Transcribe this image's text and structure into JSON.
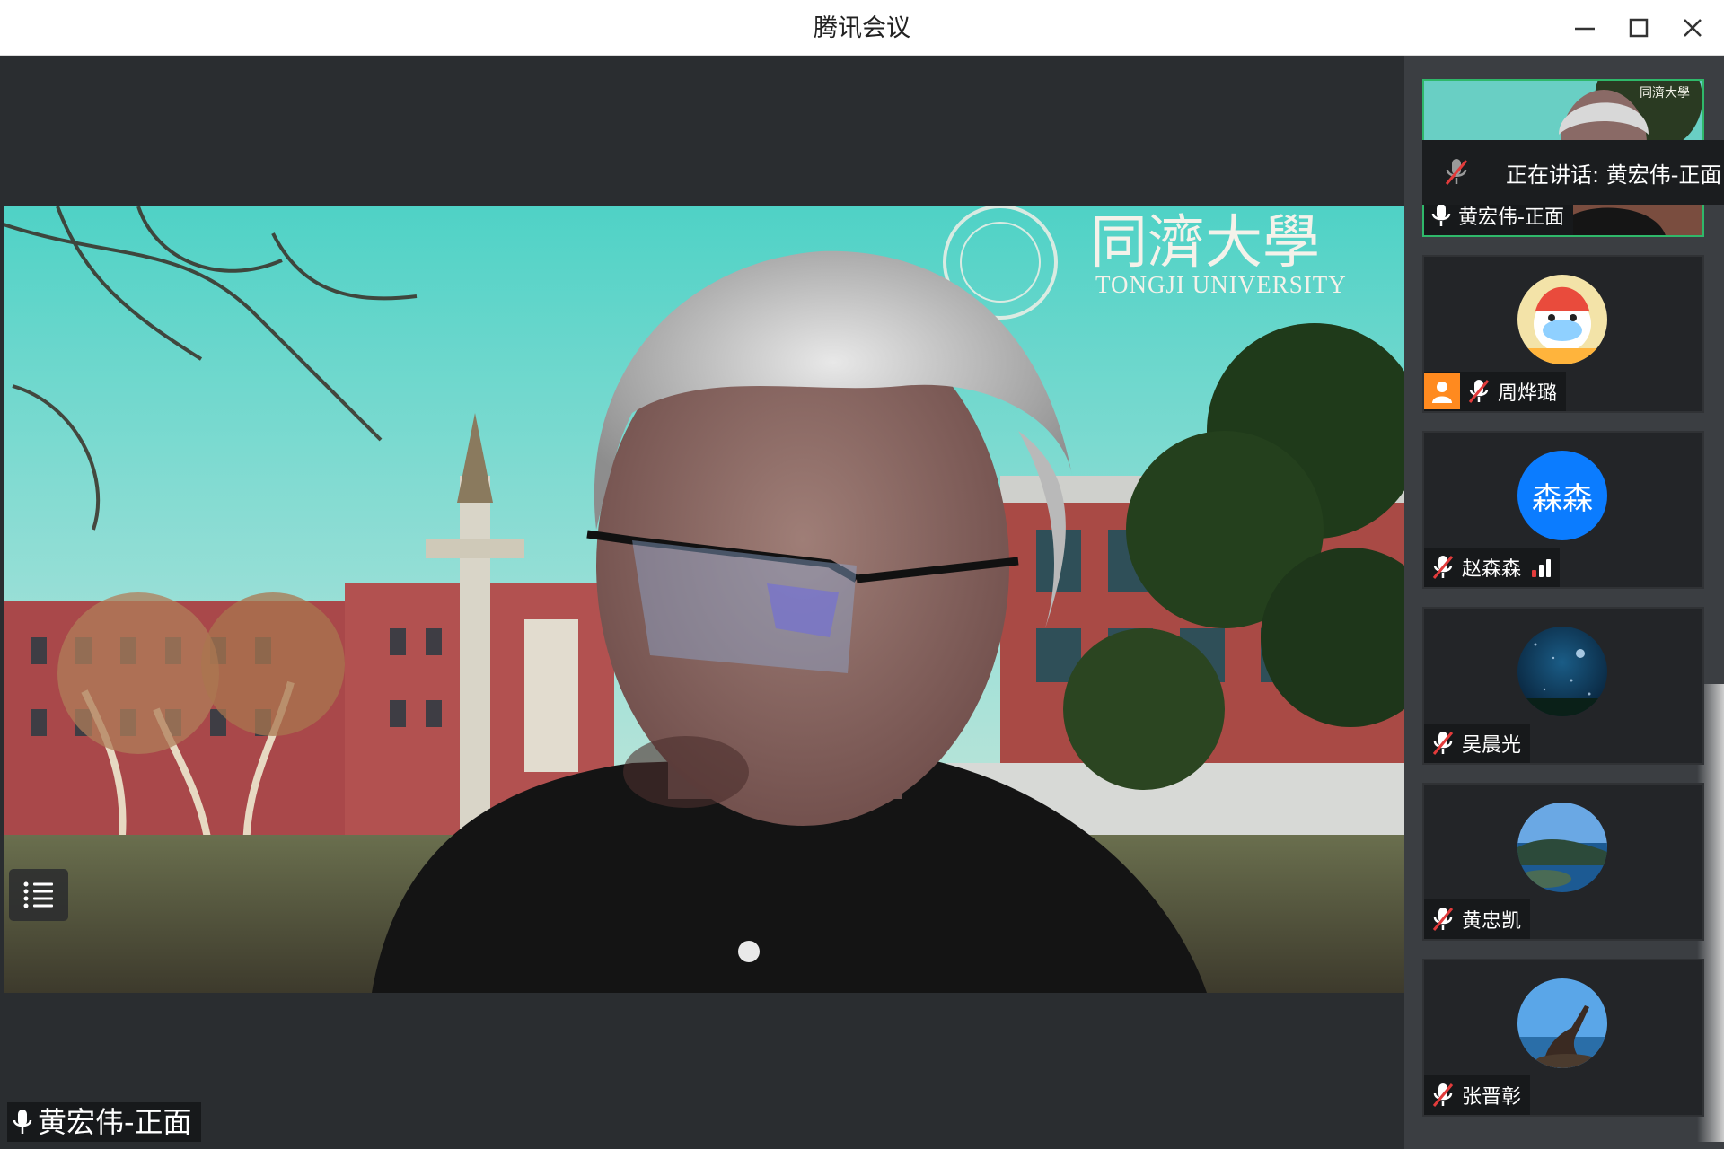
{
  "window": {
    "title": "腾讯会议"
  },
  "main_video": {
    "speaker_name": "黄宏伟-正面",
    "watermark_cn": "同濟大學",
    "watermark_en": "TONGJI UNIVERSITY"
  },
  "speaking_indicator": {
    "text": "正在讲话: 黄宏伟-正面"
  },
  "participants": [
    {
      "name": "黄宏伟-正面",
      "state": "speaking-video"
    },
    {
      "name": "周烨璐",
      "state": "muted-host"
    },
    {
      "name": "赵森森",
      "avatar_text": "森森",
      "state": "muted"
    },
    {
      "name": "吴晨光",
      "state": "muted"
    },
    {
      "name": "黄忠凯",
      "state": "muted"
    },
    {
      "name": "张晋彰",
      "state": "muted"
    }
  ],
  "colors": {
    "active_border": "#2fb86a",
    "host_badge": "#ff8a1f",
    "avatar_blue": "#0b7cff",
    "signal_red": "#e23b3b"
  }
}
